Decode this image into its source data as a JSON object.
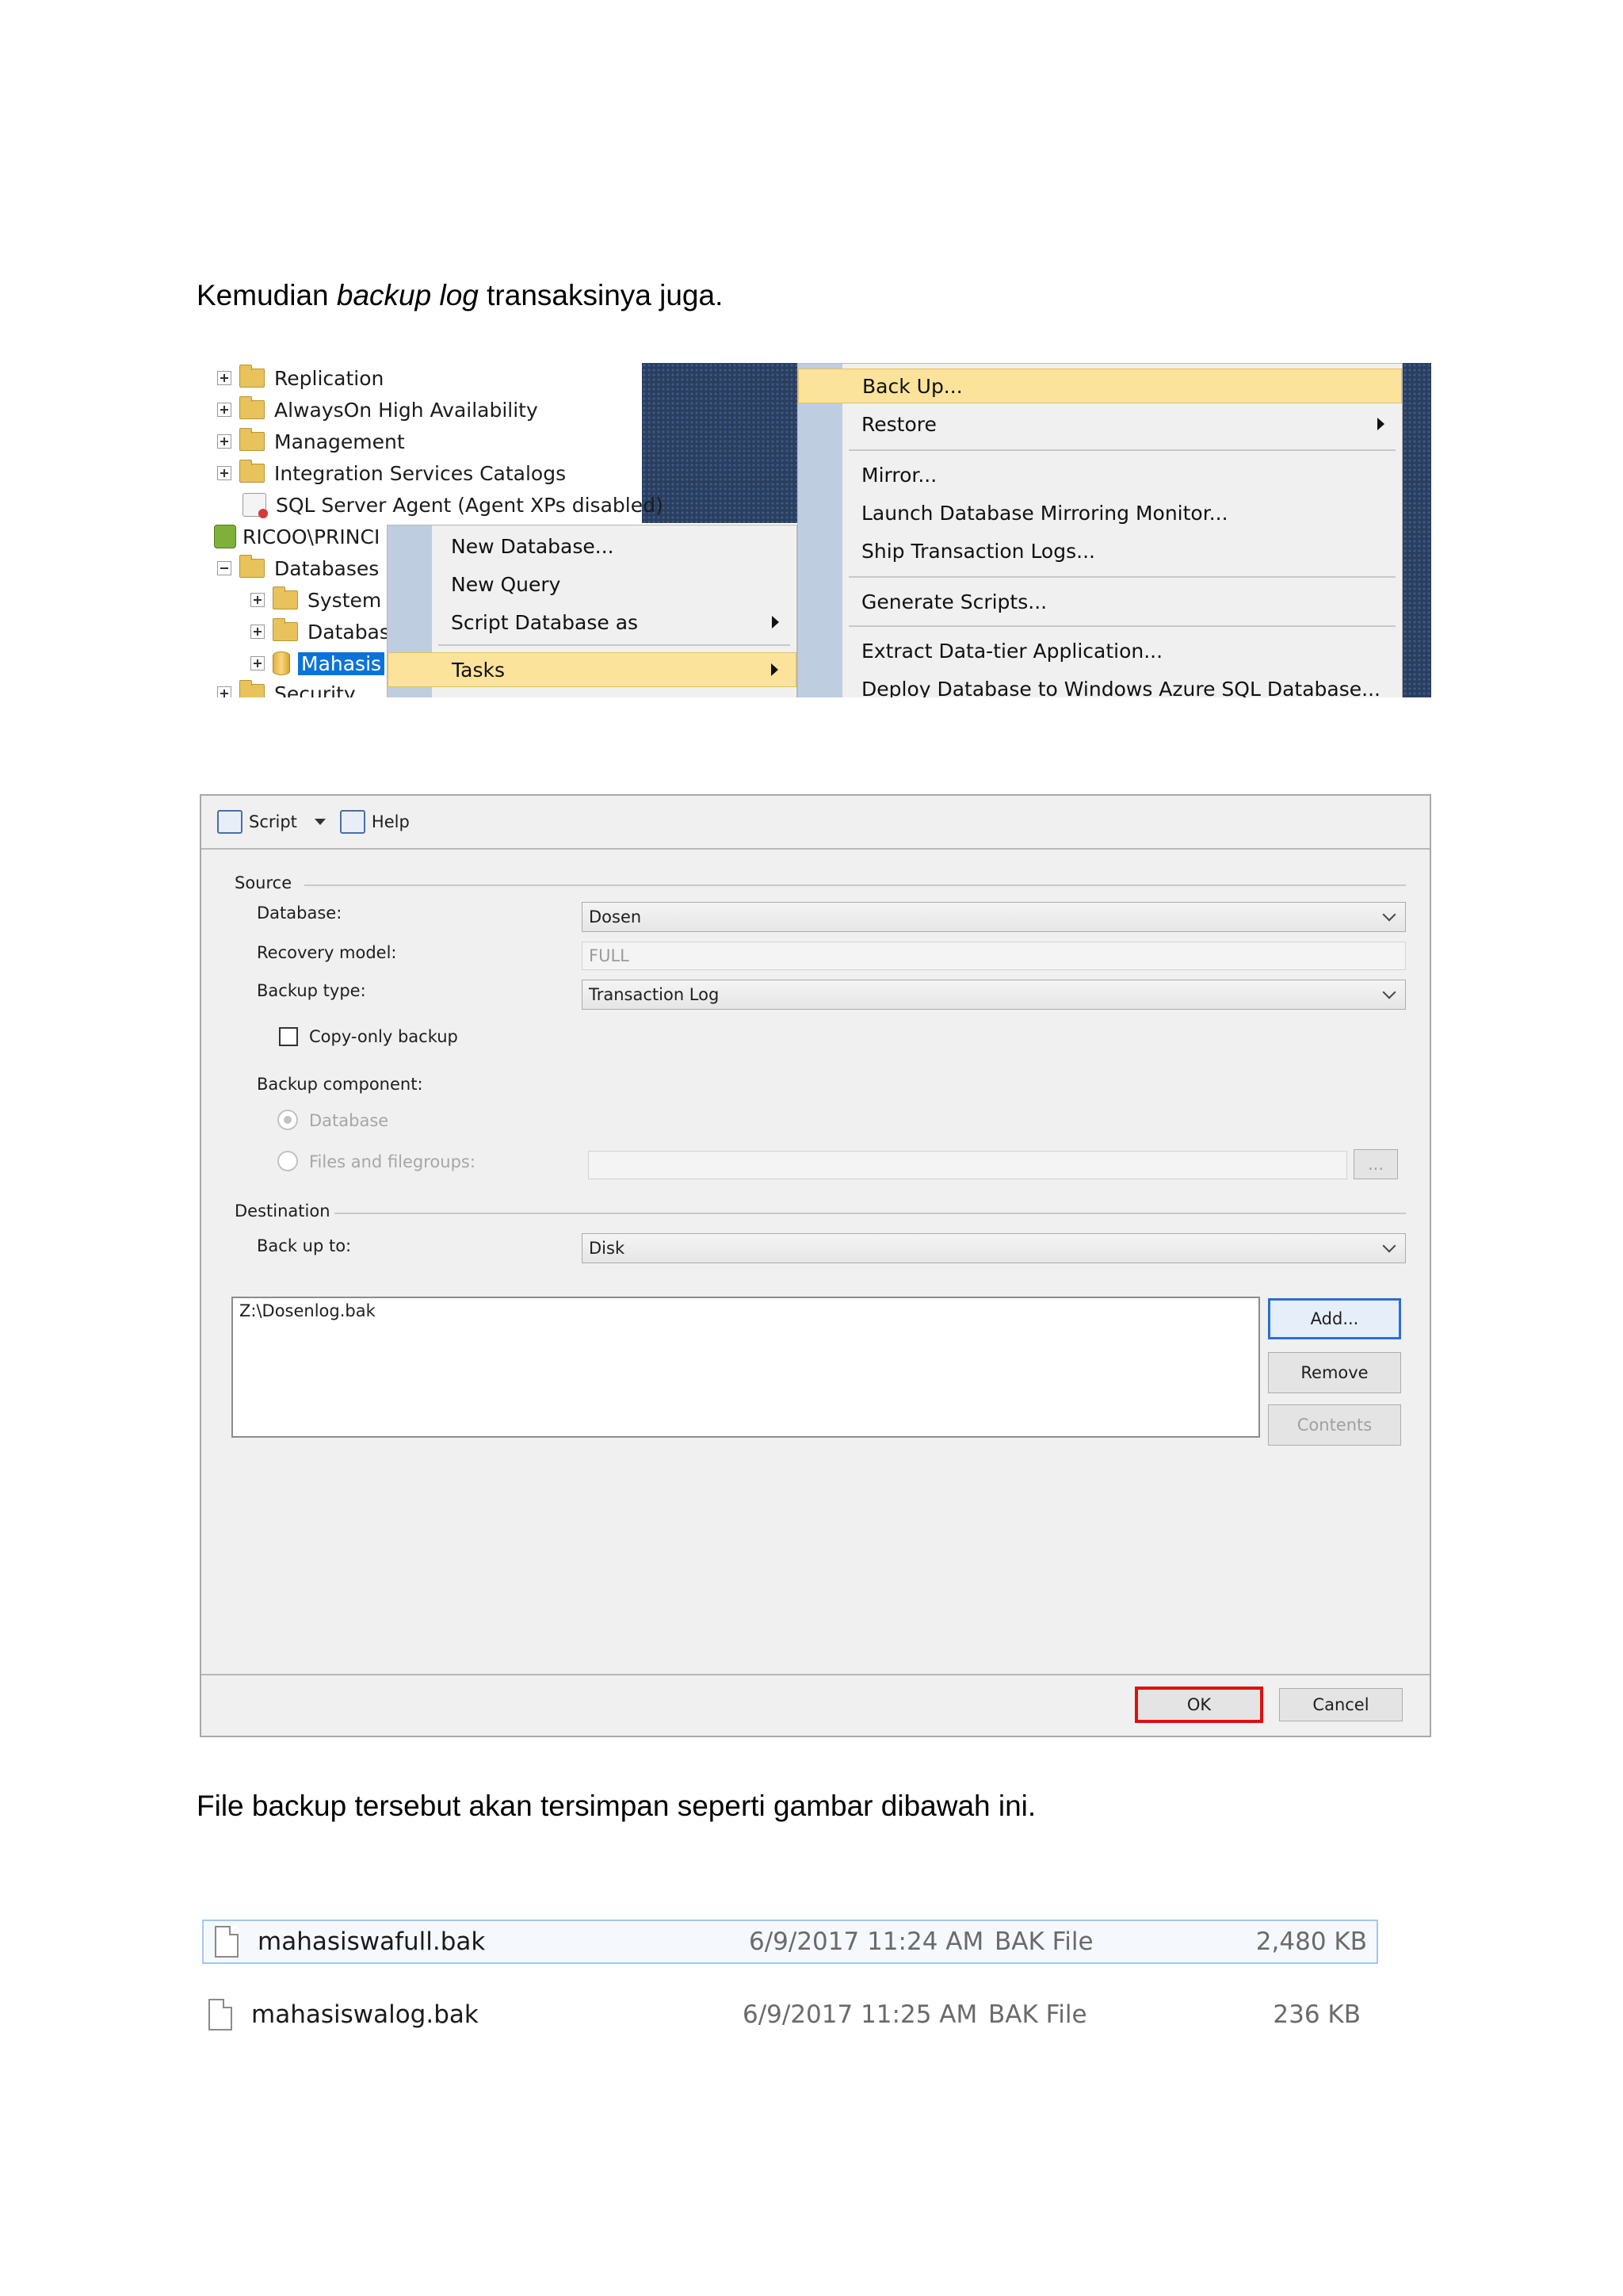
{
  "document": {
    "para1_prefix": "Kemudian ",
    "para1_italic": "backup log",
    "para1_suffix": " transaksinya juga.",
    "para2": "File backup tersebut akan tersimpan seperti gambar dibawah ini."
  },
  "object_explorer": {
    "items": [
      {
        "label": "Replication"
      },
      {
        "label": "AlwaysOn High Availability"
      },
      {
        "label": "Management"
      },
      {
        "label": "Integration Services Catalogs"
      },
      {
        "label": "SQL Server Agent (Agent XPs disabled)"
      },
      {
        "label": "RICOO\\PRINCI"
      },
      {
        "label": "Databases"
      },
      {
        "label": "System"
      },
      {
        "label": "Databas"
      },
      {
        "label": "Mahasis"
      },
      {
        "label": "Security"
      }
    ]
  },
  "context_menu": {
    "items": [
      {
        "label": "New Database..."
      },
      {
        "label": "New Query"
      },
      {
        "label": "Script Database as"
      },
      {
        "label": "Tasks"
      }
    ]
  },
  "tasks_submenu": {
    "items": [
      {
        "label": "Back Up..."
      },
      {
        "label": "Restore"
      },
      {
        "label": "Mirror..."
      },
      {
        "label": "Launch Database Mirroring Monitor..."
      },
      {
        "label": "Ship Transaction Logs..."
      },
      {
        "label": "Generate Scripts..."
      },
      {
        "label": "Extract Data-tier Application..."
      },
      {
        "label": "Deploy Database to Windows Azure SQL Database..."
      }
    ]
  },
  "backup_dialog": {
    "toolbar": {
      "script": "Script",
      "help": "Help"
    },
    "source": {
      "title": "Source",
      "database_label": "Database:",
      "database_value": "Dosen",
      "recovery_label": "Recovery model:",
      "recovery_value": "FULL",
      "backup_type_label": "Backup type:",
      "backup_type_value": "Transaction Log",
      "copy_only_label": "Copy-only backup",
      "copy_only_checked": false,
      "component_label": "Backup component:",
      "radio_database": "Database",
      "radio_files": "Files and filegroups:",
      "browse_button": "..."
    },
    "destination": {
      "title": "Destination",
      "back_up_to_label": "Back up to:",
      "back_up_to_value": "Disk",
      "paths": [
        "Z:\\Dosenlog.bak"
      ],
      "add_button": "Add...",
      "remove_button": "Remove",
      "contents_button": "Contents"
    },
    "footer": {
      "ok_button": "OK",
      "cancel_button": "Cancel"
    }
  },
  "file_list": {
    "rows": [
      {
        "name": "mahasiswafull.bak",
        "date": "6/9/2017 11:24 AM",
        "type": "BAK File",
        "size": "2,480 KB"
      },
      {
        "name": "mahasiswalog.bak",
        "date": "6/9/2017 11:25 AM",
        "type": "BAK File",
        "size": "236 KB"
      }
    ]
  },
  "colors": {
    "menu_highlight": "#fbe39c",
    "selection_blue": "#0b73d8",
    "ok_outline_red": "#e01010",
    "focus_blue": "#2a6fd6"
  }
}
